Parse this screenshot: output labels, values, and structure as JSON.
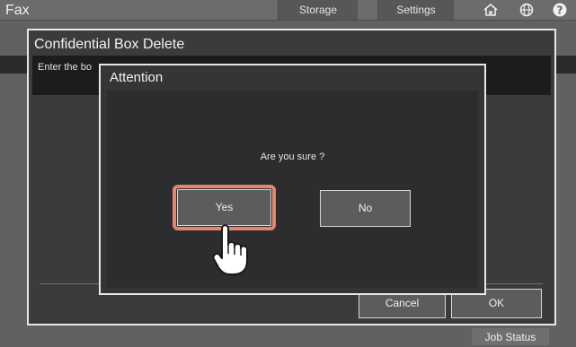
{
  "app": {
    "title": "Fax"
  },
  "topbar": {
    "tabs": [
      "Storage",
      "Settings"
    ],
    "icons": [
      "home-icon",
      "globe-icon",
      "help-icon"
    ]
  },
  "dialog": {
    "title": "Confidential Box Delete",
    "prompt": "Enter the bo",
    "cancel_label": "Cancel",
    "ok_label": "OK"
  },
  "attention": {
    "title": "Attention",
    "message": "Are you sure ?",
    "yes_label": "Yes",
    "no_label": "No",
    "highlight_color": "#e5856d"
  },
  "footer": {
    "job_status_label": "Job Status"
  }
}
